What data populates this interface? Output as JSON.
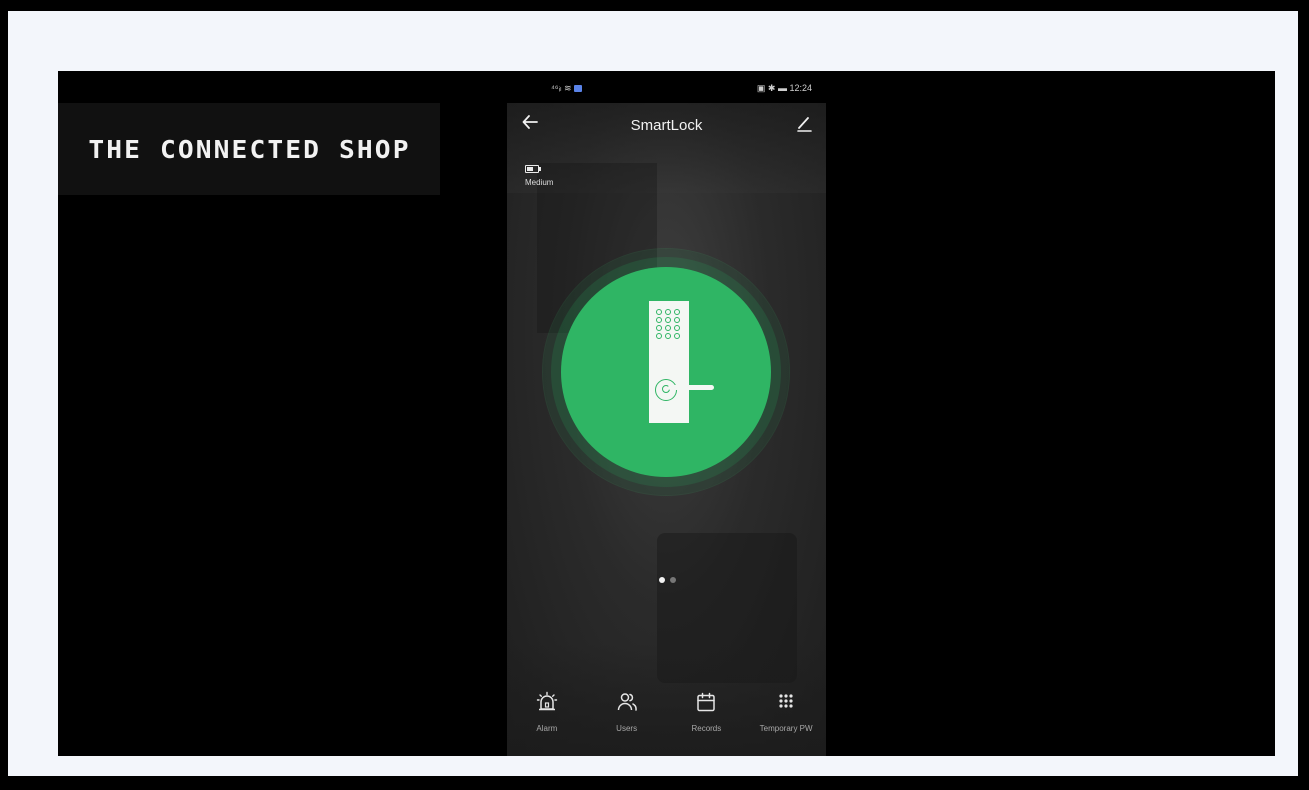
{
  "logo": {
    "text": "THE CONNECTED SHOP"
  },
  "status_bar": {
    "left": "⁴⁶ᵢₗ ≋",
    "right": "▣ ✱ ▬ 12:24"
  },
  "header": {
    "title": "SmartLock",
    "back_icon": "arrow-left-icon",
    "edit_icon": "pencil-icon"
  },
  "battery": {
    "icon": "battery-icon",
    "label": "Medium"
  },
  "lock": {
    "icon": "door-lock-icon",
    "accent_color": "#2fb564"
  },
  "pager": {
    "pages": 2,
    "active_page": 1
  },
  "bottom_nav": {
    "items": [
      {
        "label": "Alarm",
        "icon": "alarm-siren-icon"
      },
      {
        "label": "Users",
        "icon": "users-icon"
      },
      {
        "label": "Records",
        "icon": "calendar-icon"
      },
      {
        "label": "Temporary PW",
        "icon": "keypad-icon"
      }
    ]
  }
}
